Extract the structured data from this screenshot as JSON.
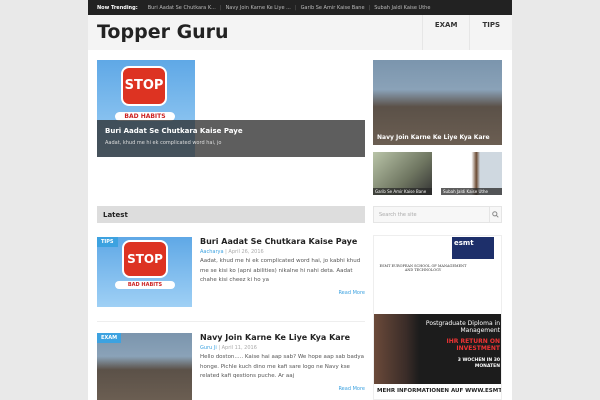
{
  "trending": {
    "label": "Now Trending:",
    "items": [
      "Buri Aadat Se Chutkara K...",
      "Navy Join Karne Ke Liye ...",
      "Garib Se Amir Kaise Bane",
      "Subah Jaldi Kaise Uthe"
    ]
  },
  "site": {
    "title": "Topper Guru"
  },
  "nav": [
    "EXAM",
    "TIPS"
  ],
  "featured": {
    "main": {
      "title": "Buri Aadat Se Chutkara Kaise Paye",
      "excerpt": "Aadat, khud me hi ek complicated word hai, jo",
      "stop": "STOP",
      "bad": "BAD HABITS"
    },
    "side": {
      "title": "Navy Join Karne Ke Liye Kya Kare"
    },
    "small": [
      {
        "title": "Garib Se Amir Kaise Bane"
      },
      {
        "title": "Subah Jaldi Kaise Uthe"
      }
    ]
  },
  "latest": {
    "heading": "Latest",
    "posts": [
      {
        "tag": "TIPS",
        "title": "Buri Aadat Se Chutkara Kaise Paye",
        "author": "Aacharya",
        "date": "April 26, 2016",
        "excerpt": "Aadat, khud me hi ek complicated word hai, jo kabhi khud me se kisi ko (apni abilities) nikalne hi nahi deta. Aadat chahe kisi cheez ki ho ya",
        "more": "Read More"
      },
      {
        "tag": "EXAM",
        "title": "Navy Join Karne Ke Liye Kya Kare",
        "author": "Guru Ji",
        "date": "April 11, 2016",
        "excerpt": "Hello doston..... Kaise hai aap sab? We hope aap sab badya honge. Pichle kuch dino me kafi sare logo ne Navy kse related kafi qestions puche. Ar aaj",
        "more": "Read More"
      }
    ]
  },
  "search": {
    "placeholder": "Search the site"
  },
  "ad": {
    "brand": "esmt",
    "school": "ESMT EUROPEAN SCHOOL OF MANAGEMENT AND TECHNOLOGY",
    "headline": "Postgraduate Diploma in Management",
    "red": "IHR RETURN ON INVESTMENT",
    "weeks": "3 WOCHEN IN 30 MONATEN",
    "footer": "MEHR INFORMATIONEN AUF WWW.ESMT.ORG"
  }
}
